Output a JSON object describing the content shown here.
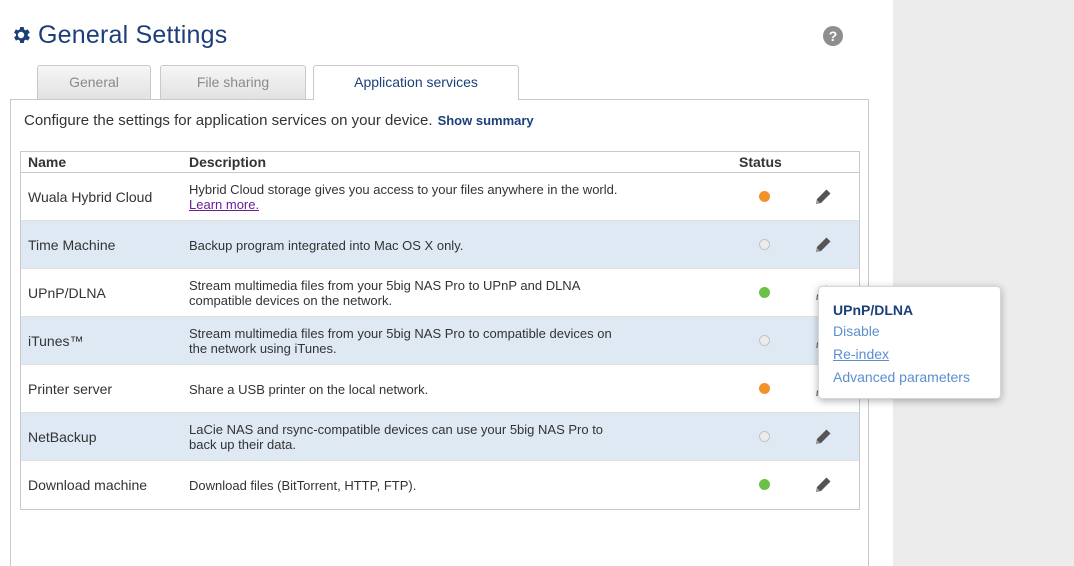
{
  "page": {
    "title": "General Settings",
    "help_label": "?"
  },
  "tabs": [
    {
      "label": "General",
      "active": false
    },
    {
      "label": "File sharing",
      "active": false
    },
    {
      "label": "Application services",
      "active": true
    }
  ],
  "intro": {
    "text": "Configure the settings for application services on your device.",
    "summary_link": "Show summary"
  },
  "table": {
    "headers": {
      "name": "Name",
      "description": "Description",
      "status": "Status"
    },
    "rows": [
      {
        "name": "Wuala Hybrid Cloud",
        "desc_line1": "Hybrid Cloud storage gives you access to your files anywhere in the world.",
        "desc_link": "Learn more.",
        "status": "orange",
        "status_color": "#f0932b"
      },
      {
        "name": "Time Machine",
        "desc_line1": "Backup program integrated into Mac OS X only.",
        "status": "grey",
        "status_color": "#d8d8d8"
      },
      {
        "name": "UPnP/DLNA",
        "desc_line1": "Stream multimedia files from your 5big NAS Pro to UPnP and DLNA",
        "desc_line2": "compatible devices on the network.",
        "status": "green",
        "status_color": "#6cc04a"
      },
      {
        "name": "iTunes™",
        "desc_line1": "Stream multimedia files from your 5big NAS Pro to compatible devices on",
        "desc_line2": "the network using iTunes.",
        "status": "grey",
        "status_color": "#d8d8d8"
      },
      {
        "name": "Printer server",
        "desc_line1": "Share a USB printer on the local network.",
        "status": "orange",
        "status_color": "#f0932b"
      },
      {
        "name": "NetBackup",
        "desc_line1": "LaCie NAS and rsync-compatible devices can use your 5big NAS Pro to",
        "desc_line2": "back up their data.",
        "status": "grey",
        "status_color": "#d8d8d8"
      },
      {
        "name": "Download machine",
        "desc_line1": "Download files (BitTorrent, HTTP, FTP).",
        "status": "green",
        "status_color": "#6cc04a"
      }
    ]
  },
  "popup": {
    "title": "UPnP/DLNA",
    "items": [
      "Disable",
      "Re-index",
      "Advanced parameters"
    ]
  },
  "icons": {
    "settings": "gear-icon",
    "help": "question-circle-icon",
    "edit": "pencil-icon"
  },
  "colors": {
    "brand": "#1c3f7a",
    "link": "#5b8fcf",
    "row_alt": "#dfe9f4",
    "status_orange": "#f0932b",
    "status_green": "#6cc04a",
    "status_grey": "#d8d8d8"
  }
}
